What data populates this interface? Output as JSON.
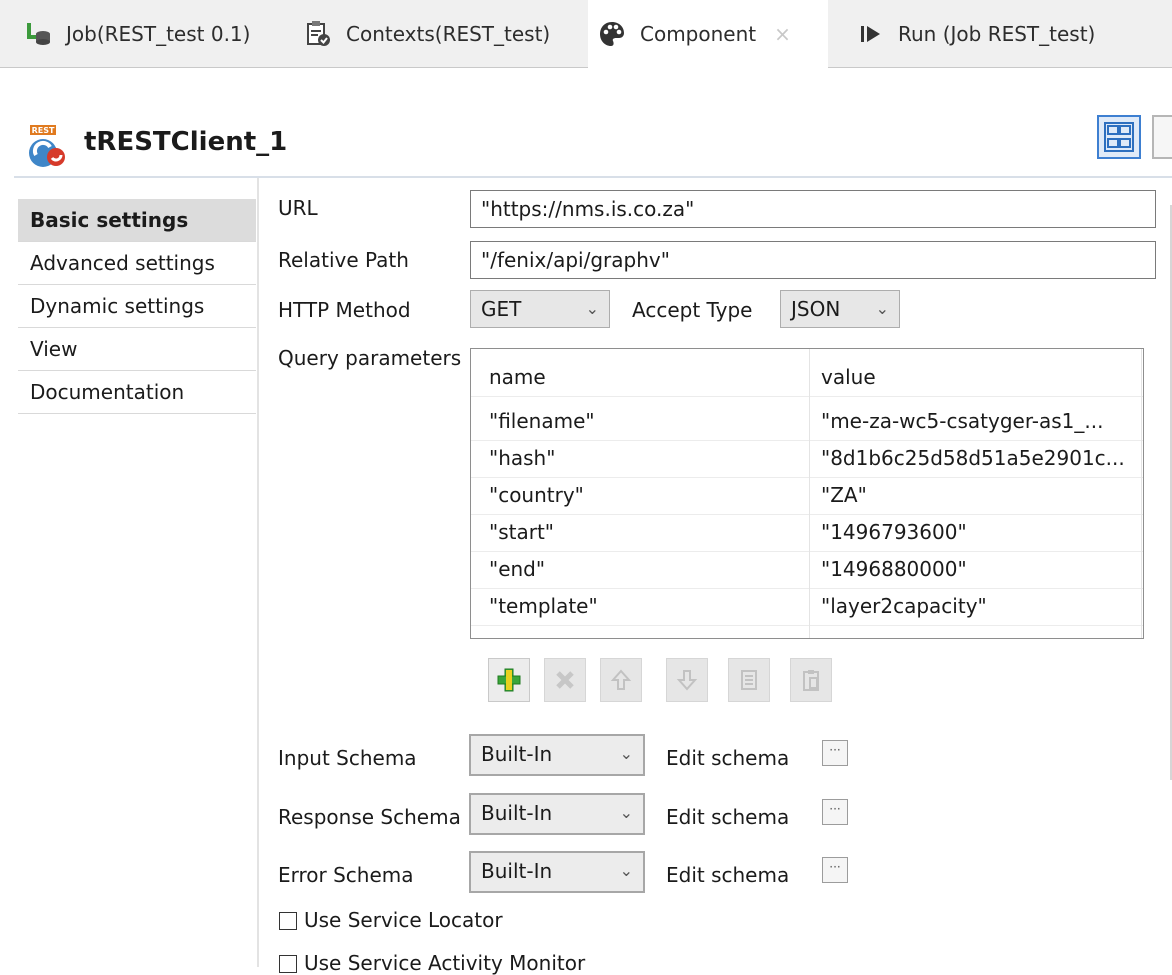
{
  "tabs": [
    {
      "label": "Job(REST_test 0.1)",
      "icon": "job-icon"
    },
    {
      "label": "Contexts(REST_test)",
      "icon": "contexts-icon"
    },
    {
      "label": "Component",
      "icon": "palette-icon",
      "close": "×"
    },
    {
      "label": "Run (Job REST_test)",
      "icon": "run-icon"
    }
  ],
  "component": {
    "title": "tRESTClient_1",
    "icon_label": "REST"
  },
  "nav": [
    {
      "label": "Basic settings"
    },
    {
      "label": "Advanced settings"
    },
    {
      "label": "Dynamic settings"
    },
    {
      "label": "View"
    },
    {
      "label": "Documentation"
    }
  ],
  "form": {
    "url_label": "URL",
    "url_value": "\"https://nms.is.co.za\"",
    "relative_path_label": "Relative Path",
    "relative_path_value": "\"/fenix/api/graphv\"",
    "http_method_label": "HTTP Method",
    "http_method_value": "GET",
    "accept_type_label": "Accept Type",
    "accept_type_value": "JSON",
    "query_params_label": "Query parameters"
  },
  "query_table": {
    "columns": [
      "name",
      "value"
    ],
    "rows": [
      {
        "name": "\"filename\"",
        "value": "\"me-za-wc5-csatyger-as1_..."
      },
      {
        "name": "\"hash\"",
        "value": "\"8d1b6c25d58d51a5e2901c..."
      },
      {
        "name": "\"country\"",
        "value": "\"ZA\""
      },
      {
        "name": "\"start\"",
        "value": "\"1496793600\""
      },
      {
        "name": "\"end\"",
        "value": "\"1496880000\""
      },
      {
        "name": "\"template\"",
        "value": "\"layer2capacity\""
      }
    ]
  },
  "toolbar": [
    "add-icon",
    "remove-icon",
    "move-up-icon",
    "move-down-icon",
    "copy-icon",
    "paste-icon"
  ],
  "schemas": [
    {
      "label": "Input Schema",
      "value": "Built-In",
      "edit": "Edit schema",
      "dots": "···"
    },
    {
      "label": "Response Schema",
      "value": "Built-In",
      "edit": "Edit schema",
      "dots": "···"
    },
    {
      "label": "Error Schema",
      "value": "Built-In",
      "edit": "Edit schema",
      "dots": "···"
    }
  ],
  "checkboxes": [
    {
      "label": "Use Service Locator",
      "checked": false
    },
    {
      "label": "Use Service Activity Monitor",
      "checked": false
    }
  ],
  "chevron": "⌄"
}
